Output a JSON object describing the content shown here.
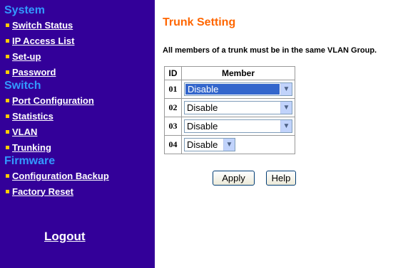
{
  "sidebar": {
    "sections": [
      {
        "title": "System",
        "items": [
          "Switch Status",
          "IP Access List",
          "Set-up",
          "Password"
        ]
      },
      {
        "title": "Switch",
        "items": [
          "Port Configuration",
          "Statistics",
          "VLAN",
          "Trunking"
        ]
      },
      {
        "title": "Firmware",
        "items": [
          "Configuration Backup",
          "Factory Reset"
        ]
      }
    ],
    "logout": "Logout"
  },
  "main": {
    "title": "Trunk Setting",
    "note": "All members of a trunk must be in the same VLAN Group.",
    "table": {
      "headers": [
        "ID",
        "Member"
      ],
      "rows": [
        {
          "id": "01",
          "member": "Disable"
        },
        {
          "id": "02",
          "member": "Disable"
        },
        {
          "id": "03",
          "member": "Disable"
        },
        {
          "id": "04",
          "member": "Disable"
        }
      ]
    },
    "buttons": {
      "apply": "Apply",
      "help": "Help"
    }
  },
  "colors": {
    "sidebar_bg": "#330099",
    "section_title": "#3399ff",
    "title": "#ff6600",
    "bullet": "#ffcc00"
  }
}
